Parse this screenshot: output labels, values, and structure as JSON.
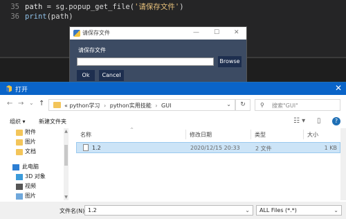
{
  "editor": {
    "lines": [
      {
        "num": "35",
        "var": "path",
        "op": " = ",
        "fn": "sg.popup_get_file",
        "open": "(",
        "str": "'请保存文件'",
        "close": ")"
      },
      {
        "num": "36",
        "fn": "print",
        "args": "(path)"
      }
    ]
  },
  "popup": {
    "title": "请保存文件",
    "label": "请保存文件",
    "input_value": "",
    "browse_label": "Browse",
    "ok_label": "Ok",
    "cancel_label": "Cancel",
    "minimize_glyph": "—",
    "maximize_glyph": "☐",
    "close_glyph": "✕"
  },
  "dialog": {
    "title": "打开",
    "close_glyph": "✕",
    "nav": {
      "back": "←",
      "forward": "→",
      "recent": "⌄",
      "up": "↑"
    },
    "address": {
      "prefix": "«",
      "crumbs": [
        "python学习",
        "python实用技能",
        "GUI"
      ],
      "chevron": "⌄"
    },
    "refresh_glyph": "↻",
    "search_placeholder": "搜索\"GUI\"",
    "search_glyph": "⚲",
    "toolbar": {
      "organize_label": "组织 ▾",
      "new_folder_label": "新建文件夹",
      "view_glyph": "☷ ▾",
      "pane_glyph": "▯",
      "help_glyph": "?"
    },
    "sidebar": {
      "items": [
        {
          "label": "附件",
          "icon": "folder-icon"
        },
        {
          "label": "图片",
          "icon": "folder-icon"
        },
        {
          "label": "文档",
          "icon": "folder-icon"
        },
        {
          "label": "此电脑",
          "icon": "computer-icon"
        },
        {
          "label": "3D 对象",
          "icon": "3d-objects-icon"
        },
        {
          "label": "视频",
          "icon": "video-icon"
        },
        {
          "label": "图片",
          "icon": "pictures-icon"
        }
      ]
    },
    "columns": {
      "name": "名称",
      "date": "修改日期",
      "type": "类型",
      "size": "大小"
    },
    "rows": [
      {
        "name": "1.2",
        "date": "2020/12/15 20:33",
        "type": "2 文件",
        "size": "1 KB"
      }
    ],
    "footer": {
      "filename_label": "文件名(N):",
      "filename_value": "1.2",
      "type_value": "ALL Files (*.*)"
    }
  }
}
